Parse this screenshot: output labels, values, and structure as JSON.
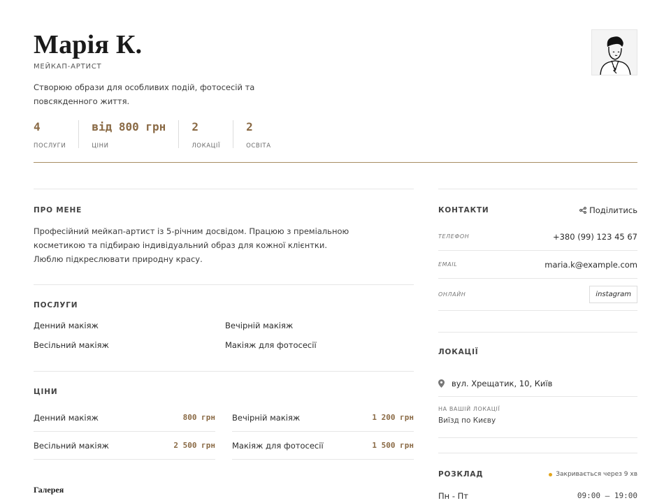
{
  "profile": {
    "name": "Марія К.",
    "role": "МЕЙКАП-АРТИСТ",
    "tagline": "Створюю образи для особливих подій, фотосесій та повсякденного життя."
  },
  "stats": [
    {
      "value": "4",
      "label": "ПОСЛУГИ"
    },
    {
      "value": "від 800 грн",
      "label": "ЦІНИ"
    },
    {
      "value": "2",
      "label": "ЛОКАЦІЇ"
    },
    {
      "value": "2",
      "label": "ОСВІТА"
    }
  ],
  "about": {
    "title": "ПРО МЕНЕ",
    "text": "Професійний мейкап-артист із 5-річним досвідом. Працюю з преміальною косметикою та підбираю індивідуальний образ для кожної клієнтки. Люблю підкреслювати природну красу."
  },
  "services": {
    "title": "ПОСЛУГИ",
    "items": [
      "Денний макіяж",
      "Вечірній макіяж",
      "Весільний макіяж",
      "Макіяж для фотосесії"
    ]
  },
  "prices": {
    "title": "ЦІНИ",
    "items": [
      {
        "name": "Денний макіяж",
        "price": "800 грн"
      },
      {
        "name": "Вечірній макіяж",
        "price": "1 200 грн"
      },
      {
        "name": "Весільний макіяж",
        "price": "2 500 грн"
      },
      {
        "name": "Макіяж для фотосесії",
        "price": "1 500 грн"
      }
    ]
  },
  "gallery": {
    "title": "Галерея"
  },
  "contacts": {
    "title": "КОНТАКТИ",
    "share_label": "Поділитись",
    "phone_label": "ТЕЛЕФОН",
    "phone": "+380 (99) 123 45 67",
    "email_label": "EMAIL",
    "email": "maria.k@example.com",
    "online_label": "ОНЛАЙН",
    "instagram": "instagram"
  },
  "locations": {
    "title": "ЛОКАЦІЇ",
    "address": "вул. Хрещатик, 10, Київ",
    "onsite_label": "НА ВАШІЙ ЛОКАЦІЇ",
    "onsite_value": "Виїзд по Києву"
  },
  "schedule": {
    "title": "РОЗКЛАД",
    "status": "Закривається через 9 хв",
    "status_color": "#e3a51c",
    "day": "Пн - Пт",
    "hours": "09:00 — 19:00"
  },
  "colors": {
    "accent": "#8a6a45",
    "rule": "#a88d63"
  }
}
